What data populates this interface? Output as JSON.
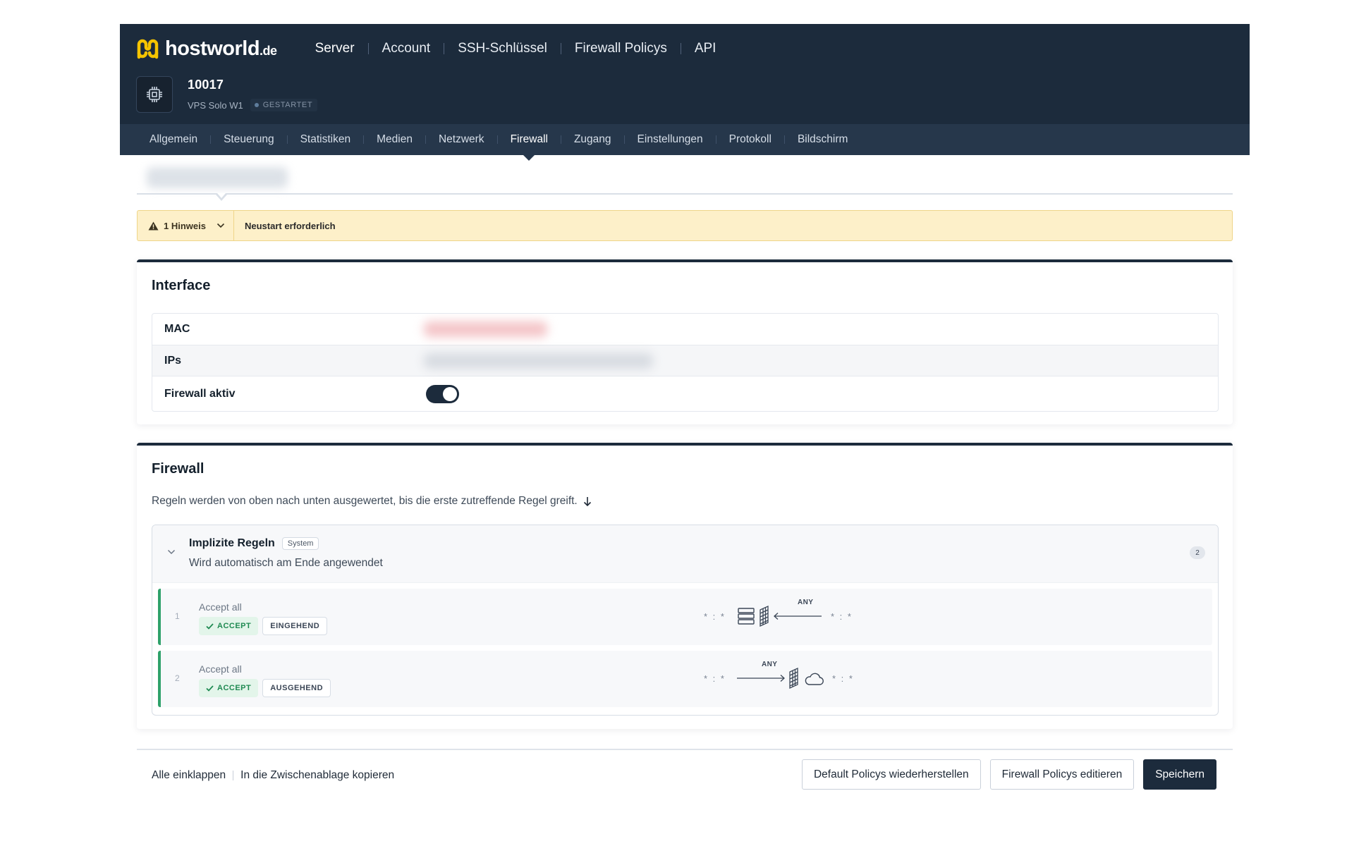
{
  "brand": {
    "name": "hostworld",
    "tld": ".de",
    "logo_color": "#f5c400"
  },
  "main_nav": [
    "Server",
    "Account",
    "SSH-Schlüssel",
    "Firewall Policys",
    "API"
  ],
  "server": {
    "id": "10017",
    "plan": "VPS Solo W1",
    "status": "GESTARTET"
  },
  "tabs": [
    "Allgemein",
    "Steuerung",
    "Statistiken",
    "Medien",
    "Netzwerk",
    "Firewall",
    "Zugang",
    "Einstellungen",
    "Protokoll",
    "Bildschirm"
  ],
  "active_tab": "Firewall",
  "notice": {
    "toggle_label": "1 Hinweis",
    "message": "Neustart erforderlich"
  },
  "interface": {
    "title": "Interface",
    "mac_label": "MAC",
    "ips_label": "IPs",
    "firewall_label": "Firewall aktiv",
    "firewall_enabled": true
  },
  "firewall": {
    "title": "Firewall",
    "description": "Regeln werden von oben nach unten ausgewertet, bis die erste zutreffende Regel greift.",
    "group": {
      "title": "Implizite Regeln",
      "badge": "System",
      "subtitle": "Wird automatisch am Ende angewendet",
      "count": "2"
    },
    "rules": [
      {
        "num": "1",
        "name": "Accept all",
        "action": "ACCEPT",
        "direction": "EINGEHEND",
        "source": "* : *",
        "target": "* : *",
        "proto": "ANY"
      },
      {
        "num": "2",
        "name": "Accept all",
        "action": "ACCEPT",
        "direction": "AUSGEHEND",
        "source": "* : *",
        "target": "* : *",
        "proto": "ANY"
      }
    ]
  },
  "footer": {
    "collapse_all": "Alle einklappen",
    "copy_clipboard": "In die Zwischenablage kopieren",
    "restore_default": "Default Policys wiederherstellen",
    "edit_policies": "Firewall Policys editieren",
    "save": "Speichern"
  },
  "colors": {
    "header": "#1c2b3c",
    "subnav": "#26374b",
    "accept": "#2ea16a",
    "notice_bg": "#fdf0c9"
  }
}
